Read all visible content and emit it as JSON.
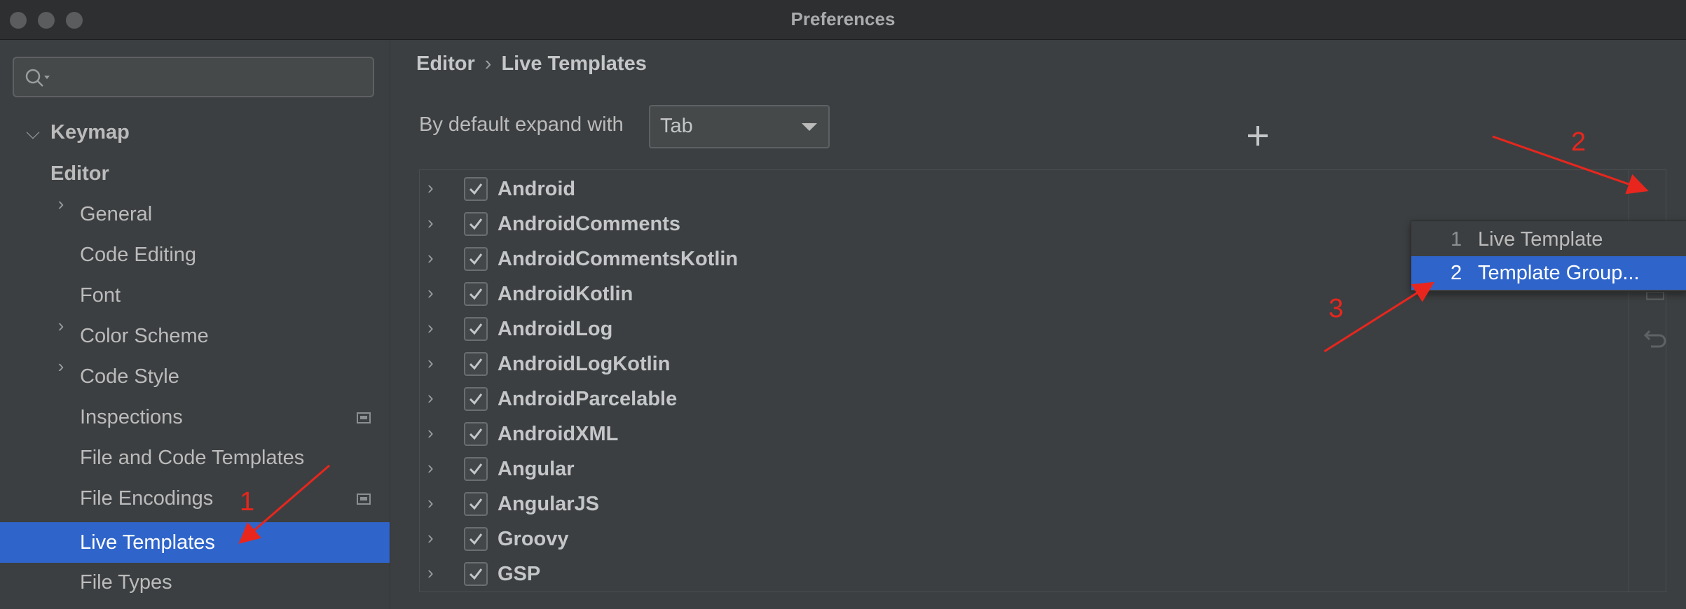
{
  "window": {
    "title": "Preferences"
  },
  "sidebar": {
    "search_placeholder": "",
    "items": [
      {
        "label": "Keymap",
        "bold": true
      },
      {
        "label": "Editor",
        "bold": true,
        "expanded": true
      },
      {
        "label": "General",
        "has_children": true
      },
      {
        "label": "Code Editing"
      },
      {
        "label": "Font"
      },
      {
        "label": "Color Scheme",
        "has_children": true
      },
      {
        "label": "Code Style",
        "has_children": true
      },
      {
        "label": "Inspections",
        "badge": true
      },
      {
        "label": "File and Code Templates"
      },
      {
        "label": "File Encodings",
        "badge": true
      },
      {
        "label": "Live Templates",
        "selected": true
      },
      {
        "label": "File Types"
      }
    ]
  },
  "breadcrumb": {
    "part1": "Editor",
    "separator": "›",
    "part2": "Live Templates"
  },
  "expand": {
    "label": "By default expand with",
    "value": "Tab"
  },
  "template_groups": [
    {
      "name": "Android",
      "checked": true
    },
    {
      "name": "AndroidComments",
      "checked": true
    },
    {
      "name": "AndroidCommentsKotlin",
      "checked": true
    },
    {
      "name": "AndroidKotlin",
      "checked": true
    },
    {
      "name": "AndroidLog",
      "checked": true
    },
    {
      "name": "AndroidLogKotlin",
      "checked": true
    },
    {
      "name": "AndroidParcelable",
      "checked": true
    },
    {
      "name": "AndroidXML",
      "checked": true
    },
    {
      "name": "Angular",
      "checked": true
    },
    {
      "name": "AngularJS",
      "checked": true
    },
    {
      "name": "Groovy",
      "checked": true
    },
    {
      "name": "GSP",
      "checked": true
    }
  ],
  "toolbar": {
    "add_icon": "plus-icon",
    "copy_icon": "copy-icon",
    "restore_icon": "undo-icon"
  },
  "popup_menu": {
    "items": [
      {
        "num": "1",
        "label": "Live Template"
      },
      {
        "num": "2",
        "label": "Template Group...",
        "selected": true
      }
    ]
  },
  "annotations": {
    "a1": "1",
    "a2": "2",
    "a3": "3",
    "color": "#e8261d"
  },
  "colors": {
    "selection": "#2f65ca",
    "background": "#3c3f41"
  }
}
